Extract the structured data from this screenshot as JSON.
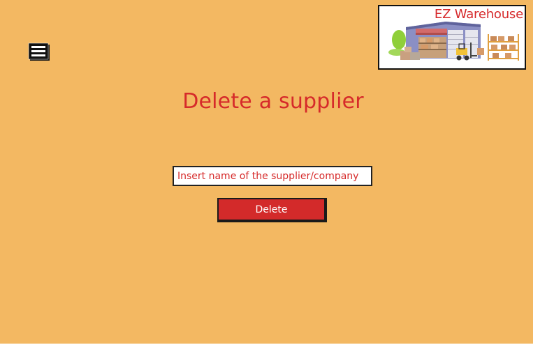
{
  "app": {
    "brand": "EZ Warehouse"
  },
  "page": {
    "title": "Delete a supplier"
  },
  "form": {
    "supplier_placeholder": "Insert name of the supplier/company",
    "supplier_value": "",
    "delete_label": "Delete"
  },
  "icons": {
    "menu": "menu-icon",
    "logo": "warehouse-logo"
  },
  "colors": {
    "background": "#f3b862",
    "accent": "#d62a2a",
    "button": "#d32a2a",
    "button_text": "#ffffff"
  }
}
